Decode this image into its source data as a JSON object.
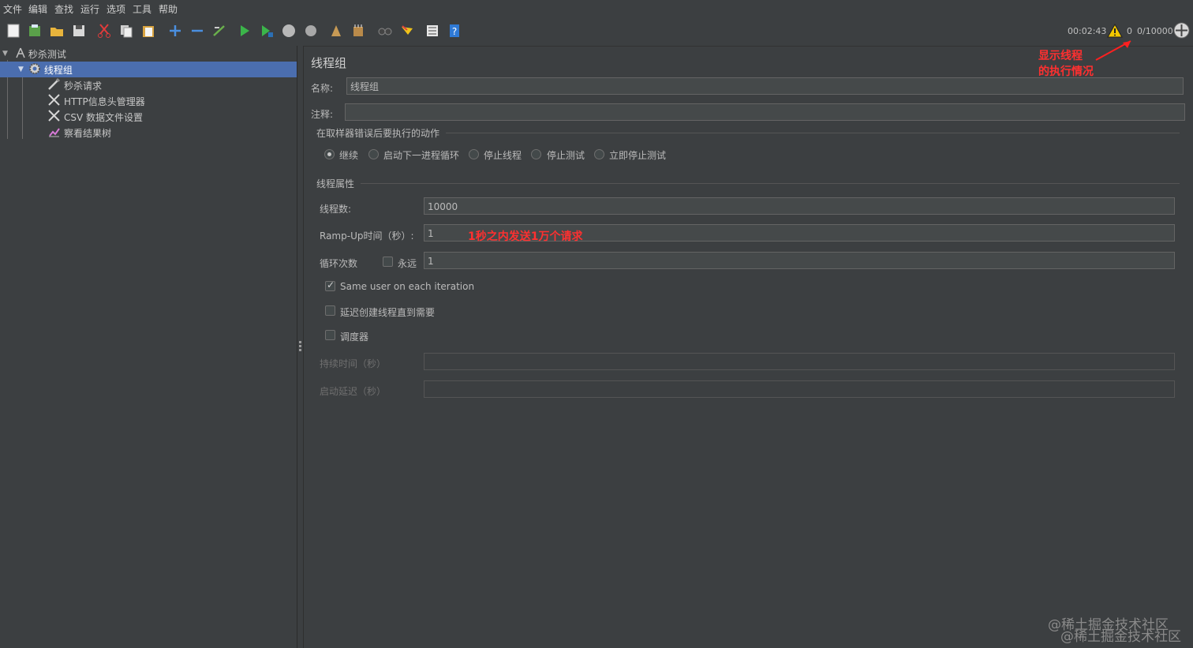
{
  "menu": [
    "文件",
    "编辑",
    "查找",
    "运行",
    "选项",
    "工具",
    "帮助"
  ],
  "toolbar_icons": [
    "new-icon",
    "templates-icon",
    "open-icon",
    "save-icon",
    "cut-icon",
    "copy-icon",
    "paste-icon",
    "expand-icon",
    "collapse-icon",
    "toggle-icon",
    "start-icon",
    "start-no-pause-icon",
    "stop-icon",
    "shutdown-icon",
    "clear-icon",
    "clear-all-icon",
    "search-icon",
    "reset-search-icon",
    "function-helper-icon",
    "help-icon"
  ],
  "status": {
    "time": "00:02:43",
    "warnings": "0",
    "threads": "0/10000"
  },
  "annotation_status": [
    "显示线程",
    "的执行情况"
  ],
  "tree": {
    "root": "秒杀测试",
    "thread_group": "线程组",
    "children": [
      "秒杀请求",
      "HTTP信息头管理器",
      "CSV 数据文件设置",
      "察看结果树"
    ]
  },
  "panel": {
    "title": "线程组",
    "name_label": "名称:",
    "name_value": "线程组",
    "comment_label": "注释:",
    "comment_value": "",
    "error_section": "在取样器错误后要执行的动作",
    "error_options": [
      "继续",
      "启动下一进程循环",
      "停止线程",
      "停止测试",
      "立即停止测试"
    ],
    "error_selected": 0,
    "thread_section": "线程属性",
    "threads_label": "线程数:",
    "threads_value": "10000",
    "rampup_label": "Ramp-Up时间（秒）:",
    "rampup_value": "1",
    "rampup_annotation": "1秒之内发送1万个请求",
    "loop_label": "循环次数",
    "forever_label": "永远",
    "forever_checked": false,
    "loop_value": "1",
    "same_user_label": "Same user on each iteration",
    "same_user_checked": true,
    "delay_label": "延迟创建线程直到需要",
    "delay_checked": false,
    "scheduler_label": "调度器",
    "scheduler_checked": false,
    "duration_label": "持续时间（秒）",
    "startup_delay_label": "启动延迟（秒）"
  },
  "watermark": "@稀土掘金技术社区"
}
